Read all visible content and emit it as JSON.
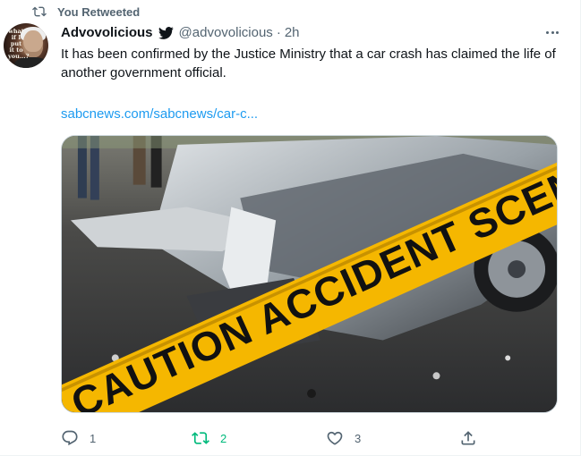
{
  "retweet_context": {
    "label": "You Retweeted"
  },
  "author": {
    "display_name": "Advovolicious",
    "handle": "@advovolicious",
    "separator": "·",
    "time": "2h",
    "avatar_text": "what if I put it to you...?"
  },
  "tweet": {
    "text": "It has been confirmed by the Justice Ministry that a car crash has claimed the life of another government official.",
    "link": "sabcnews.com/sabcnews/car-c..."
  },
  "media": {
    "tape_text": "CAUTION ACCIDENT SCENE",
    "tape_color": "#f5b700"
  },
  "actions": {
    "reply_count": "1",
    "retweet_count": "2",
    "like_count": "3"
  },
  "colors": {
    "text_primary": "#0f1419",
    "text_secondary": "#536471",
    "link": "#1d9bf0",
    "retweet_active": "#00ba7c"
  }
}
